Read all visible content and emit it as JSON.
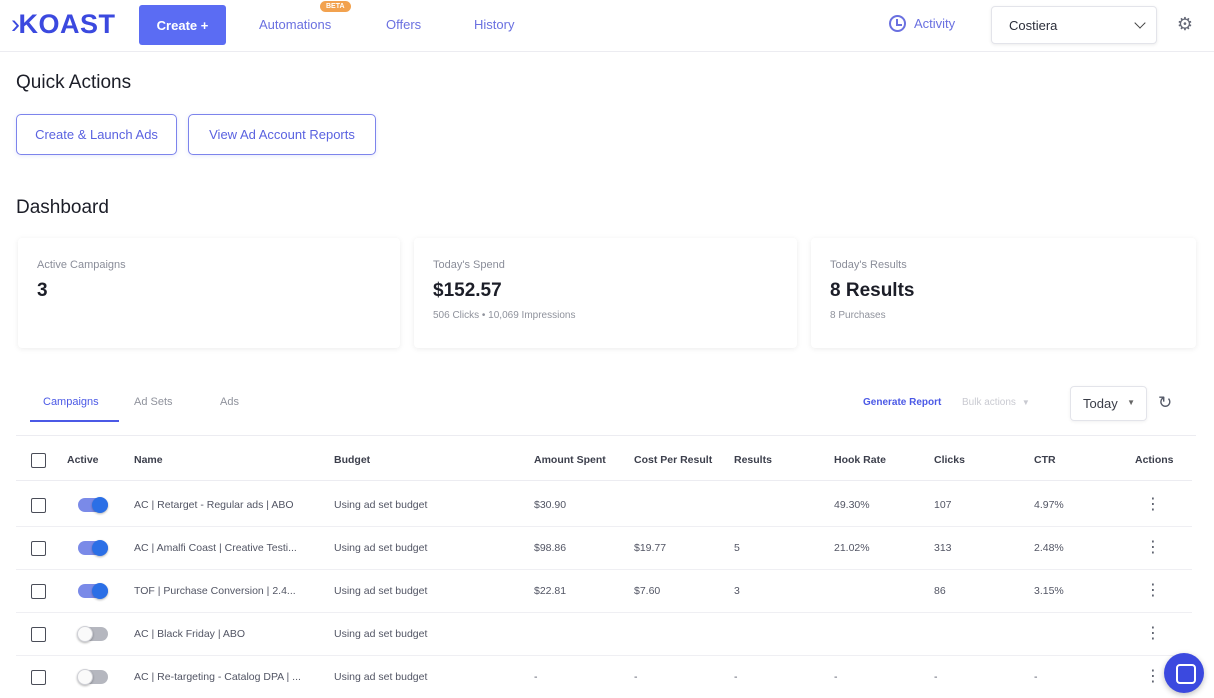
{
  "nav": {
    "logo": "KOAST",
    "logo_mark": "›",
    "create_label": "Create +",
    "automations_label": "Automations",
    "beta_badge": "BETA",
    "offers_label": "Offers",
    "history_label": "History",
    "activity_label": "Activity",
    "account_selected": "Costiera"
  },
  "quick_actions": {
    "title": "Quick Actions",
    "buttons": [
      "Create & Launch Ads",
      "View Ad Account Reports"
    ]
  },
  "dashboard": {
    "title": "Dashboard",
    "cards": [
      {
        "label": "Active Campaigns",
        "value": "3",
        "sub": ""
      },
      {
        "label": "Today's Spend",
        "value": "$152.57",
        "sub": "506 Clicks • 10,069 Impressions"
      },
      {
        "label": "Today's Results",
        "value": "8 Results",
        "sub": "8 Purchases"
      }
    ]
  },
  "tabs": [
    "Campaigns",
    "Ad Sets",
    "Ads"
  ],
  "toolbar": {
    "generate_report": "Generate Report",
    "bulk_actions": "Bulk actions",
    "date_range": "Today"
  },
  "table": {
    "columns": [
      "Active",
      "Name",
      "Budget",
      "Amount Spent",
      "Cost Per Result",
      "Results",
      "Hook Rate",
      "Clicks",
      "CTR",
      "Actions"
    ],
    "rows": [
      {
        "active": true,
        "name": "AC | Retarget - Regular ads | ABO",
        "budget": "Using ad set budget",
        "amount_spent": "$30.90",
        "cost_per_result": "",
        "results": "",
        "hook_rate": "49.30%",
        "clicks": "107",
        "ctr": "4.97%"
      },
      {
        "active": true,
        "name": "AC | Amalfi Coast | Creative Testi...",
        "budget": "Using ad set budget",
        "amount_spent": "$98.86",
        "cost_per_result": "$19.77",
        "results": "5",
        "hook_rate": "21.02%",
        "clicks": "313",
        "ctr": "2.48%"
      },
      {
        "active": true,
        "name": "TOF | Purchase Conversion | 2.4...",
        "budget": "Using ad set budget",
        "amount_spent": "$22.81",
        "cost_per_result": "$7.60",
        "results": "3",
        "hook_rate": "",
        "clicks": "86",
        "ctr": "3.15%"
      },
      {
        "active": false,
        "name": "AC | Black Friday | ABO",
        "budget": "Using ad set budget",
        "amount_spent": "",
        "cost_per_result": "",
        "results": "",
        "hook_rate": "",
        "clicks": "",
        "ctr": ""
      },
      {
        "active": false,
        "name": "AC | Re-targeting - Catalog DPA | ...",
        "budget": "Using ad set budget",
        "amount_spent": "-",
        "cost_per_result": "-",
        "results": "-",
        "hook_rate": "-",
        "clicks": "-",
        "ctr": "-"
      }
    ]
  },
  "icons": {
    "activity": "clock-icon",
    "settings": "gear-icon",
    "refresh": "refresh-icon",
    "row_actions": "kebab-menu-icon",
    "chat": "chat-icon"
  },
  "colors": {
    "brand": "#3b49df",
    "primary_button": "#5b6cf3",
    "link": "#4b59e6",
    "beta_badge": "#f2a24f",
    "toggle_on": "#2b6fe6"
  }
}
